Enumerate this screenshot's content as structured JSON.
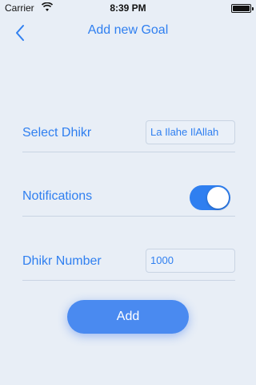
{
  "status_bar": {
    "carrier": "Carrier",
    "time": "8:39 PM",
    "wifi_icon": "wifi-icon",
    "battery_icon": "battery-icon"
  },
  "nav": {
    "back_icon": "chevron-left-icon",
    "title": "Add new Goal"
  },
  "form": {
    "select_dhikr": {
      "label": "Select Dhikr",
      "value": "La Ilahe IlAllah"
    },
    "notifications": {
      "label": "Notifications",
      "enabled": true
    },
    "dhikr_number": {
      "label": "Dhikr Number",
      "value": "1000"
    }
  },
  "add_button": {
    "label": "Add"
  },
  "colors": {
    "accent": "#2f7ff0",
    "background": "#e8eef6",
    "button": "#4a8af0"
  }
}
